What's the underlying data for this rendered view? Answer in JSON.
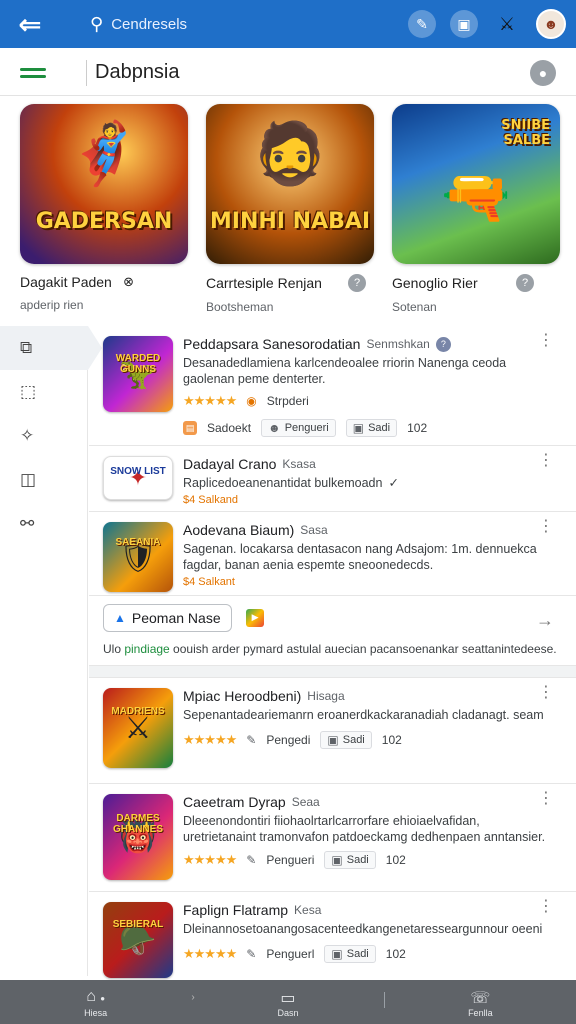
{
  "appbar": {
    "search_text": "Cendresels"
  },
  "titlebar": {
    "title": "Dabpnsia"
  },
  "featured": [
    {
      "logo": "GADERSAN",
      "name": "Dagakit Paden",
      "sub": "apderip rien",
      "badge": "⊗"
    },
    {
      "logo": "MINHI NABAI",
      "name": "Carrtesiple Renjan",
      "sub": "Bootsheman",
      "badge": "?"
    },
    {
      "logo": "SNIIBE SALBE",
      "name": "Genoglio Rier",
      "sub": "Sotenan",
      "badge": "?"
    }
  ],
  "list": {
    "items": [
      {
        "title": "Peddapsara Sanesorodatian",
        "tag": "Senmshkan",
        "desc": "Desanadedlamiena karlcendeoalee rriorin Nanenga ceoda gaolenan peme denterter.",
        "thumb_label": "WARDED GUNNS",
        "rating_stars": "★★★★★",
        "meta_text": "Strpderi",
        "chip1": "Sadoekt",
        "chip2": "Pengueri",
        "chip3": "Sadi",
        "count": "102"
      },
      {
        "title": "Dadayal Crano",
        "tag": "Ksasa",
        "desc": "Raplicedoeanenantidat bulkemoadn",
        "price": "$4 Salkand",
        "thumb_label": "SNOW LIST"
      },
      {
        "title": "Aodevana Biaum)",
        "tag": "Sasa",
        "desc": "Sagenan. locakarsa dentasacon nang Adsajom:           1m. dennuekca fagdar, banan aenia espemte sneoonedecds.",
        "price": "$4 Salkant",
        "thumb_label": "SAEANIA"
      }
    ],
    "promo": {
      "button": "Peoman Nase",
      "text_green": "pindiage",
      "text_pre": "Ulo ",
      "text_post": " oouish arder pymard astulal auecian pacansoenankar seattanintedeese."
    },
    "items2": [
      {
        "title": "Mpiac Heroodbeni)",
        "tag": "Hisaga",
        "desc": "Sepenantadeariemanrn eroanerdkackaranadiah cladanagt. seam",
        "thumb_label": "MADRIENS",
        "rating_stars": "★★★★★",
        "chip2": "Pengedi",
        "chip3": "Sadi",
        "count": "102"
      },
      {
        "title": "Caeetram Dyrap",
        "tag": "Seaa",
        "desc": "Dleeenondontiri fiiohaolrtarlcarrorfare ehioiaelvafidan, uretrietanaint tramonvafon patdoeckamg dedhenpaen anntansier.",
        "thumb_label": "DARMES GHANNES",
        "rating_stars": "★★★★★",
        "chip2": "Pengueri",
        "chip3": "Sadi",
        "count": "102"
      },
      {
        "title": "Faplign Flatramp",
        "tag": "Kesa",
        "desc": "Dleinannosetoanangosacenteedkangenetaresseargunnour oeeni",
        "thumb_label": "SEBIERAL",
        "rating_stars": "★★★★★",
        "chip2": "Penguerl",
        "chip3": "Sadi",
        "count": "102"
      }
    ]
  },
  "bottom_nav": [
    {
      "label": "Hiesa",
      "icon": "home-icon"
    },
    {
      "label": "Dasn",
      "icon": "box-icon"
    },
    {
      "label": "Fenlla",
      "icon": "chat-icon"
    }
  ],
  "colors": {
    "appbar": "#1f6fc8",
    "accent_green": "#1e8e3e",
    "star": "#f5a623",
    "bottom_nav": "#5f6368"
  }
}
